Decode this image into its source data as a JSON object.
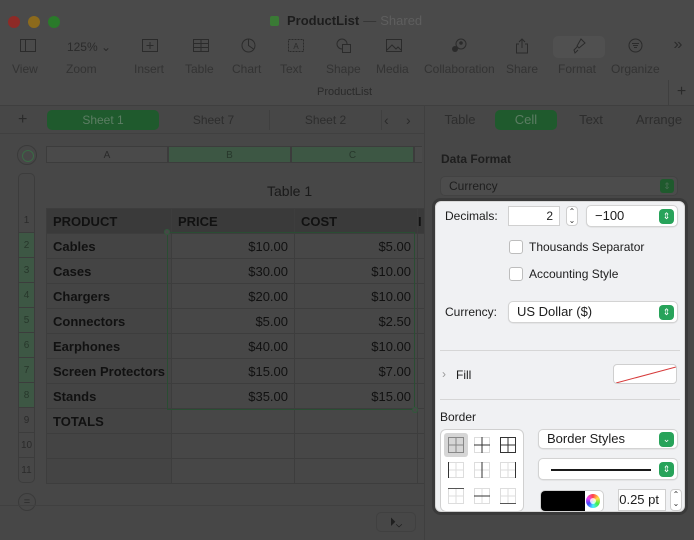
{
  "window": {
    "doc_name": "ProductList",
    "separator": "—",
    "status": "Shared",
    "doc_title_bar": "ProductList"
  },
  "toolbar": {
    "items": [
      {
        "label": "View",
        "icon": "sidebar-icon"
      },
      {
        "label": "Zoom",
        "value": "125%",
        "icon": "chevron-down-icon"
      },
      {
        "label": "Insert",
        "icon": "plus-square-icon"
      },
      {
        "label": "Table",
        "icon": "table-icon"
      },
      {
        "label": "Chart",
        "icon": "pie-chart-icon"
      },
      {
        "label": "Text",
        "icon": "text-box-icon"
      },
      {
        "label": "Shape",
        "icon": "shape-icon"
      },
      {
        "label": "Media",
        "icon": "photo-icon"
      },
      {
        "label": "Collaboration",
        "icon": "collaboration-icon"
      },
      {
        "label": "Share",
        "icon": "share-icon"
      },
      {
        "label": "Format",
        "icon": "paintbrush-icon",
        "active": true
      },
      {
        "label": "Organize",
        "icon": "filter-icon"
      }
    ],
    "overflow_icon": "»",
    "zoom_value": "125%"
  },
  "sheets": {
    "tabs": [
      "Sheet 1",
      "Sheet 7",
      "Sheet 2"
    ],
    "active": "Sheet 1"
  },
  "grid": {
    "columns": [
      "A",
      "B",
      "C"
    ],
    "selected_columns": [
      "B",
      "C"
    ],
    "rows": [
      "1",
      "2",
      "3",
      "4",
      "5",
      "6",
      "7",
      "8",
      "9",
      "10",
      "11"
    ],
    "selected_rows": [
      "2",
      "3",
      "4",
      "5",
      "6",
      "7",
      "8"
    ],
    "table_title": "Table 1",
    "headers": [
      "PRODUCT",
      "PRICE",
      "COST",
      "I"
    ],
    "body": [
      [
        "Cables",
        "$10.00",
        "$5.00"
      ],
      [
        "Cases",
        "$30.00",
        "$10.00"
      ],
      [
        "Chargers",
        "$20.00",
        "$10.00"
      ],
      [
        "Connectors",
        "$5.00",
        "$2.50"
      ],
      [
        "Earphones",
        "$40.00",
        "$10.00"
      ],
      [
        "Screen Protectors",
        "$15.00",
        "$7.00"
      ],
      [
        "Stands",
        "$35.00",
        "$15.00"
      ],
      [
        "TOTALS",
        "",
        ""
      ],
      [
        "",
        "",
        ""
      ],
      [
        "",
        "",
        ""
      ]
    ]
  },
  "inspector": {
    "tabs": [
      "Table",
      "Cell",
      "Text",
      "Arrange"
    ],
    "active_tab": "Cell",
    "data_format_label": "Data Format",
    "data_format_value": "Currency",
    "decimals_label": "Decimals:",
    "decimals_value": "2",
    "negative_format": "−100",
    "thousands_separator_label": "Thousands Separator",
    "thousands_separator_checked": false,
    "accounting_style_label": "Accounting Style",
    "accounting_style_checked": false,
    "currency_label": "Currency:",
    "currency_value": "US Dollar ($)",
    "fill_label": "Fill",
    "fill_value": "none",
    "border_label": "Border",
    "border_styles_label": "Border Styles",
    "border_color": "#000000",
    "border_width": "0.25 pt"
  },
  "colors": {
    "accent_green": "#27a35a",
    "dim_active_tab": "#1f5a2d",
    "panel_bg": "#f0f1f3"
  }
}
